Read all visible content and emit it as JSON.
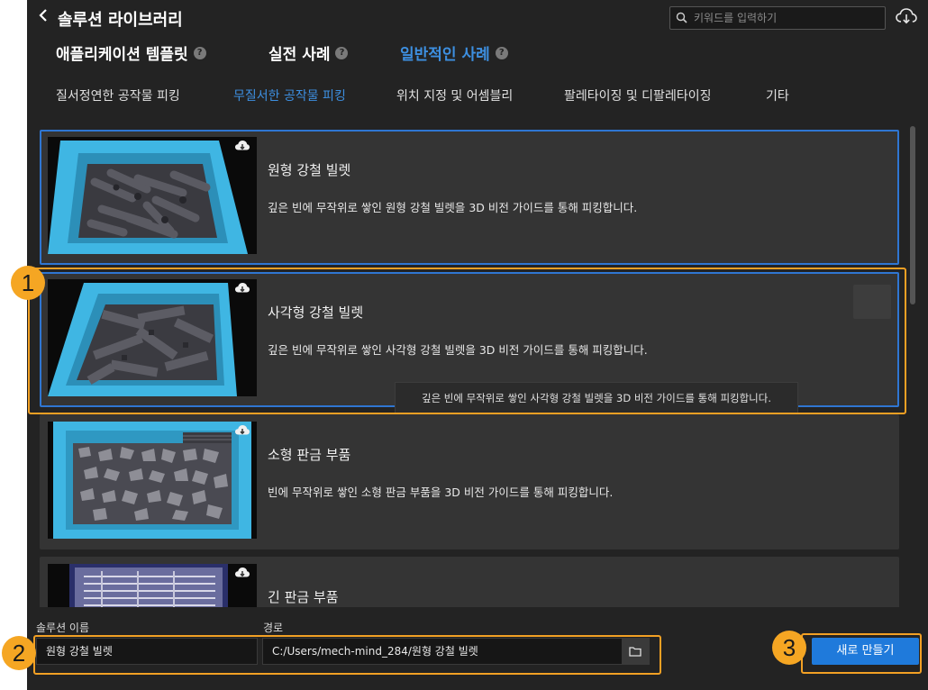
{
  "header": {
    "title": "솔루션 라이브러리",
    "search_placeholder": "키워드를 입력하기"
  },
  "main_tabs": [
    {
      "label": "애플리케이션 템플릿",
      "active": false
    },
    {
      "label": "실전 사례",
      "active": false
    },
    {
      "label": "일반적인 사례",
      "active": true
    }
  ],
  "help_glyph": "?",
  "sub_tabs": [
    {
      "label": "질서정연한 공작물 피킹",
      "active": false
    },
    {
      "label": "무질서한 공작물 피킹",
      "active": true
    },
    {
      "label": "위치 지정 및 어셈블리",
      "active": false
    },
    {
      "label": "팔레타이징 및 디팔레타이징",
      "active": false
    },
    {
      "label": "기타",
      "active": false
    }
  ],
  "cards": [
    {
      "title": "원형 강철 빌렛",
      "description": "깊은 빈에 무작위로 쌓인 원형 강철 빌렛을 3D 비전 가이드를 통해 피킹합니다.",
      "selected": true
    },
    {
      "title": "사각형 강철 빌렛",
      "description": "깊은 빈에 무작위로 쌓인 사각형 강철 빌렛을 3D 비전 가이드를 통해 피킹합니다.",
      "selected": true
    },
    {
      "title": "소형 판금 부품",
      "description": "빈에 무작위로 쌓인 소형 판금 부품을 3D 비전 가이드를 통해 피킹합니다.",
      "selected": false
    },
    {
      "title": "긴 판금 부품",
      "description": "",
      "selected": false
    }
  ],
  "tooltip": "깊은 빈에 무작위로 쌓인 사각형 강철 빌렛을 3D 비전 가이드를 통해 피킹합니다.",
  "footer": {
    "name_label": "솔루션 이름",
    "name_value": "원형 강철 빌렛",
    "path_label": "경로",
    "path_value": "C:/Users/mech-mind_284/원형 강철 빌렛",
    "create_label": "새로 만들기"
  },
  "annotations": [
    "1",
    "2",
    "3"
  ],
  "colors": {
    "accent": "#1f7adb",
    "active_tab": "#3d8fe0",
    "annotation": "#f5a623",
    "bin": "#3fb6e3"
  },
  "icons": [
    "back-arrow-icon",
    "search-icon",
    "cloud-download-icon",
    "help-icon",
    "download-icon",
    "folder-icon"
  ]
}
